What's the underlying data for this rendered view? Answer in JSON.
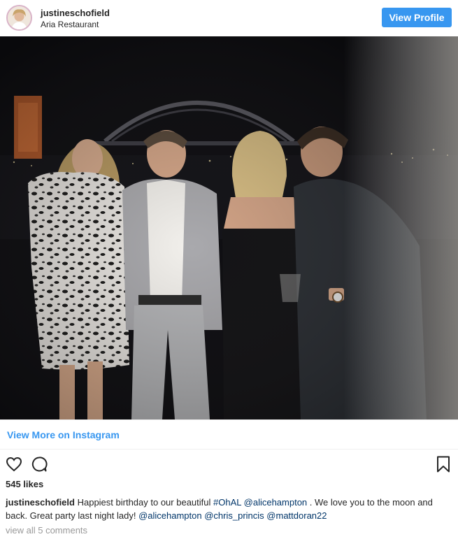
{
  "header": {
    "username": "justineschofield",
    "location": "Aria Restaurant",
    "view_profile_label": "View Profile"
  },
  "post": {
    "view_more_label": "View More on Instagram",
    "likes": "545 likes",
    "caption": {
      "username": "justineschofield",
      "text_1": "Happiest birthday to our beautiful",
      "hashtag": "#OhAL",
      "mention_1": "@alicehampton",
      "text_2": ". We love you to the moon and back. Great party last night lady!",
      "mention_2": "@alicehampton",
      "mention_3": "@chris_princis",
      "mention_4": "@mattdoran22"
    },
    "comments_link": "view all 5 comments"
  },
  "icons": {
    "like": "heart-outline-icon",
    "comment": "speech-bubble-icon",
    "save": "bookmark-icon"
  },
  "colors": {
    "accent": "#3897f0",
    "hashtag": "#003569",
    "muted": "#999999"
  }
}
